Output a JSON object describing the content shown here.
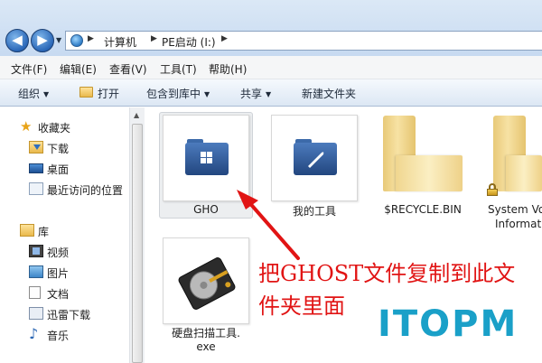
{
  "address_bar": {
    "back_glyph": "◀",
    "forward_glyph": "▶",
    "crumbs": [
      "计算机",
      "PE启动 (I:)"
    ]
  },
  "menu": [
    "文件(F)",
    "编辑(E)",
    "查看(V)",
    "工具(T)",
    "帮助(H)"
  ],
  "toolbar": {
    "organize": "组织",
    "open": "打开",
    "include_in_library": "包含到库中",
    "share": "共享",
    "new_folder": "新建文件夹"
  },
  "nav": {
    "favorites": "收藏夹",
    "downloads": "下载",
    "desktop": "桌面",
    "recent": "最近访问的位置",
    "libraries": "库",
    "videos": "视频",
    "pictures": "图片",
    "documents": "文档",
    "xunlei": "迅雷下载",
    "music": "音乐"
  },
  "files": {
    "gho": "GHO",
    "my_tools": "我的工具",
    "recycle": "$RECYCLE.BIN",
    "sysvol_line1": "System Vo",
    "sysvol_line2": "Informat",
    "disk_tool_line1": "硬盘扫描工具.",
    "disk_tool_line2": "exe"
  },
  "annotation": {
    "line1": "把GHOST文件复制到此文",
    "line2": "件夹里面",
    "color": "#e11414"
  },
  "logo": {
    "text": "ITOPM",
    "color": "#1aa0c8"
  }
}
